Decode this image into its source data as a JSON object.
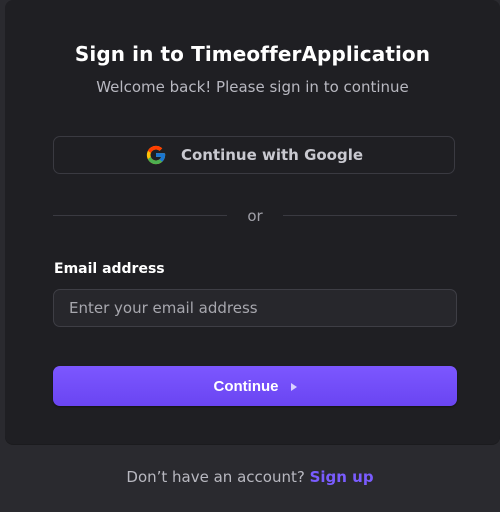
{
  "header": {
    "title": "Sign in to TimeofferApplication",
    "subtitle": "Welcome back! Please sign in to continue"
  },
  "social": {
    "google_label": "Continue with Google",
    "google_icon": "google-icon"
  },
  "divider": {
    "text": "or"
  },
  "form": {
    "email_label": "Email address",
    "email_placeholder": "Enter your email address",
    "email_value": "",
    "continue_label": "Continue",
    "continue_icon": "play-arrow-icon"
  },
  "footer": {
    "prompt": "Don’t have an account?",
    "signup_label": "Sign up"
  },
  "colors": {
    "accent": "#6c47ff",
    "card_background": "#1f1f23",
    "page_background": "#2a2a2f",
    "link": "#7a5cff"
  }
}
